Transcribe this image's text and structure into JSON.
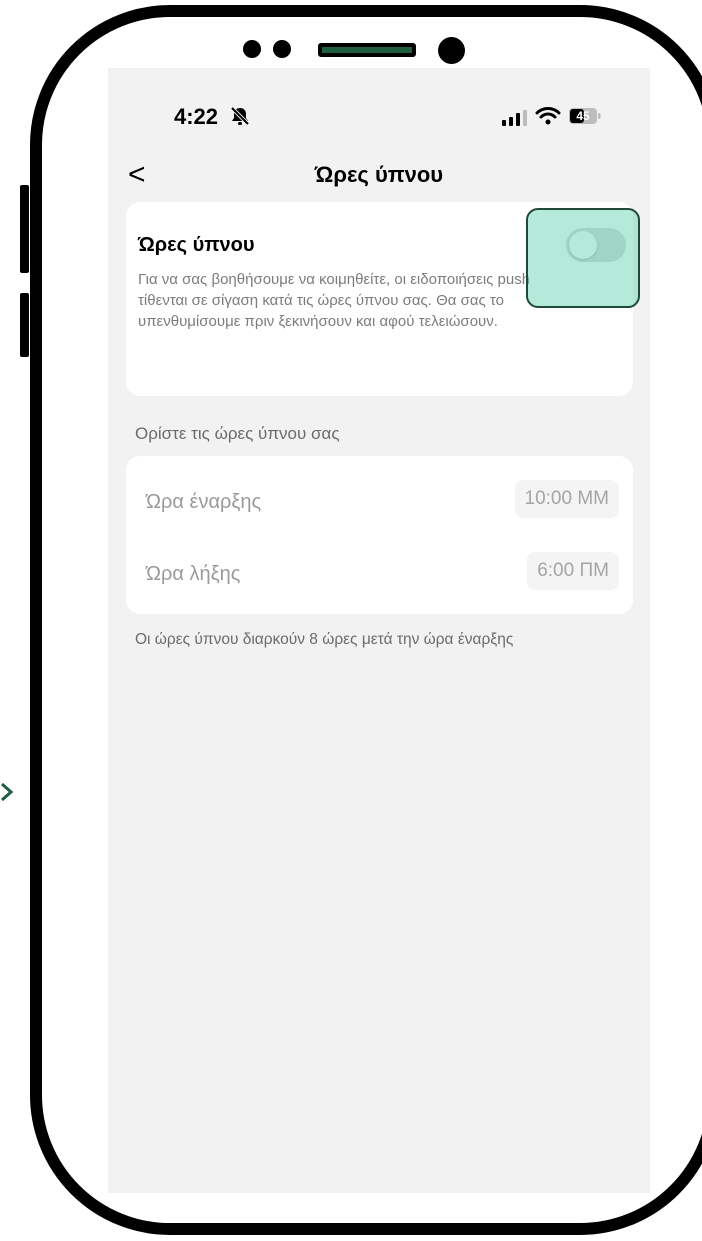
{
  "status_bar": {
    "time": "4:22",
    "battery": "45"
  },
  "nav": {
    "back_glyph": "<",
    "title": "Ώρες ύπνου"
  },
  "sleep_card": {
    "title": "Ώρες ύπνου",
    "description": "Για να σας βοηθήσουμε να κοιμηθείτε, οι ειδοποιήσεις push τίθενται σε σίγαση κατά τις ώρες ύπνου σας. Θα σας το υπενθυμίσουμε πριν ξεκινήσουν και αφού τελειώσουν.",
    "toggle_on": false
  },
  "schedule": {
    "section_label": "Ορίστε τις ώρες ύπνου σας",
    "start_label": "Ώρα έναρξης",
    "start_value": "10:00 ΜΜ",
    "end_label": "Ώρα λήξης",
    "end_value": "6:00 ΠΜ",
    "footnote": "Οι ώρες ύπνου διαρκούν 8 ώρες μετά την ώρα έναρξης"
  },
  "icons": [
    "bell-slash-icon",
    "cellular-signal-icon",
    "wifi-icon",
    "battery-icon",
    "back-chevron-icon"
  ],
  "colors": {
    "highlight": "#78d7b9",
    "highlight_border": "#1e4a35",
    "accent_green": "#1e5e3e"
  }
}
